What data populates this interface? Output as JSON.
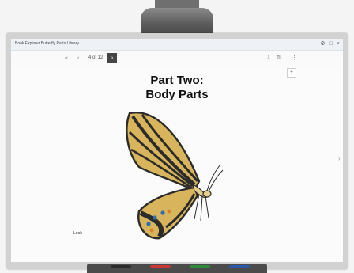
{
  "window": {
    "title": "Book Explorer Butterfly Parts Library",
    "controls": [
      "⚙",
      "□",
      "×"
    ]
  },
  "toolbar": {
    "prev_first": "«",
    "prev": "‹",
    "page_indicator": "4 of 12",
    "go_label": "»",
    "right_icons": [
      "⇩",
      "⇅",
      "⋮"
    ]
  },
  "content": {
    "title_line1": "Part Two:",
    "title_line2": "Body Parts",
    "footer_note": "Look",
    "corner_button": "+"
  },
  "colors": {
    "wing_yellow": "#d8b45c",
    "wing_black": "#2b2b2b",
    "wing_blue": "#2f6fb0",
    "wing_orange": "#d9812a",
    "pens": [
      "#2c2c2c",
      "#c8373a",
      "#2f8a3b",
      "#2b59a6"
    ]
  }
}
